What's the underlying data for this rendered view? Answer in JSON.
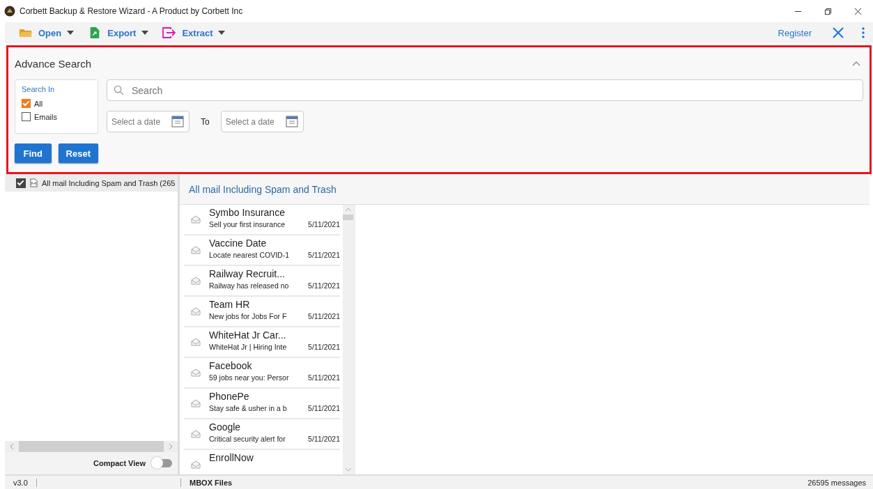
{
  "window": {
    "title": "Corbett Backup & Restore Wizard - A Product by Corbett Inc"
  },
  "toolbar": {
    "menus": [
      {
        "label": "Open",
        "kind": "open"
      },
      {
        "label": "Export",
        "kind": "export"
      },
      {
        "label": "Extract",
        "kind": "extract"
      }
    ],
    "register": "Register"
  },
  "advance_search": {
    "title": "Advance Search",
    "expanded": true,
    "search_in": {
      "title": "Search In",
      "options": [
        {
          "label": "All",
          "checked": true
        },
        {
          "label": "Emails",
          "checked": false
        }
      ]
    },
    "search": {
      "placeholder": "Search"
    },
    "date_from": {
      "placeholder": "Select a date"
    },
    "to_label": "To",
    "date_to": {
      "placeholder": "Select a date"
    },
    "buttons": [
      "Find",
      "Reset"
    ]
  },
  "folder_tree": {
    "items": [
      {
        "label": "All mail Including Spam and Trash  (265",
        "checked": true
      }
    ],
    "compact_view": {
      "label": "Compact View",
      "on": false
    }
  },
  "mail_list": {
    "title": "All mail Including Spam and Trash",
    "items": [
      {
        "sender": "Symbo Insurance",
        "snippet": "Sell your first insurance",
        "date": "5/11/2021"
      },
      {
        "sender": "Vaccine Date",
        "snippet": "Locate nearest COVID-1",
        "date": "5/11/2021"
      },
      {
        "sender": "Railway Recruit...",
        "snippet": "Railway has released no",
        "date": "5/11/2021"
      },
      {
        "sender": "Team HR",
        "snippet": "New jobs for Jobs For F",
        "date": "5/11/2021"
      },
      {
        "sender": "WhiteHat Jr Car...",
        "snippet": "WhiteHat Jr | Hiring Inte",
        "date": "5/11/2021"
      },
      {
        "sender": "Facebook",
        "snippet": "59 jobs near you: Persor",
        "date": "5/11/2021"
      },
      {
        "sender": "PhonePe",
        "snippet": "Stay safe & usher in a b",
        "date": "5/11/2021"
      },
      {
        "sender": "Google",
        "snippet": "Critical security alert for",
        "date": "5/11/2021"
      },
      {
        "sender": "EnrollNow"
      }
    ]
  },
  "status_bar": {
    "version": "v3.0",
    "source": "MBOX Files",
    "count": "26595 messages"
  }
}
